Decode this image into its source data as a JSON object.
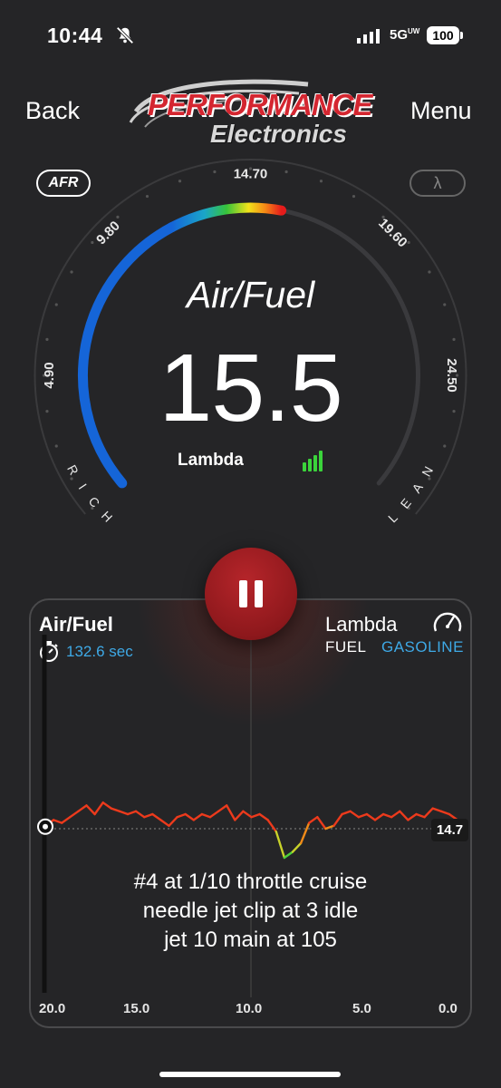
{
  "status_bar": {
    "time": "10:44",
    "network": "5G",
    "network_sub": "UW",
    "battery": "100"
  },
  "header": {
    "back_label": "Back",
    "menu_label": "Menu",
    "logo_line1": "PERFORMANCE",
    "logo_line2": "Electronics"
  },
  "gauge": {
    "mode_afr": "AFR",
    "mode_lambda": "λ",
    "title": "Air/Fuel",
    "value": "15.5",
    "unit_label": "Lambda",
    "scale_labels": [
      "4.90",
      "9.80",
      "14.70",
      "19.60",
      "24.50"
    ],
    "rich_label": "RICH",
    "lean_label": "LEAN",
    "scale_min": 4.9,
    "scale_max": 24.5,
    "current": 15.5,
    "signal_bars": 4,
    "colors": {
      "arc_blue": "#1565d8",
      "signal": "#3bd43b"
    }
  },
  "controls": {
    "pause_icon": "pause-icon"
  },
  "chart_panel": {
    "title": "Air/Fuel",
    "timer": "132.6 sec",
    "right_title": "Lambda",
    "fuel_label": "FUEL",
    "fuel_value": "GASOLINE",
    "current_value": "14.7",
    "note": "#4 at 1/10 throttle cruise\nneedle jet clip at 3 idle\njet 10 main at 105",
    "x_ticks": [
      "20.0",
      "15.0",
      "10.0",
      "5.0",
      "0.0"
    ]
  },
  "chart_data": {
    "type": "line",
    "xlabel": "",
    "ylabel": "",
    "xlim": [
      20.0,
      0.0
    ],
    "reference_value": 14.7,
    "series": [
      {
        "x": [
          20.0,
          19.6,
          19.2,
          18.8,
          18.4,
          18.0,
          17.6,
          17.2,
          16.8,
          16.4,
          16.0,
          15.6,
          15.2,
          14.8,
          14.4,
          14.0,
          13.6,
          13.2,
          12.8,
          12.4,
          12.0,
          11.6,
          11.2,
          10.8,
          10.4,
          10.0,
          9.6,
          9.2,
          8.8,
          8.4,
          8.0,
          7.6,
          7.2,
          6.8,
          6.4,
          6.0,
          5.6,
          5.2,
          4.8,
          4.4,
          4.0,
          3.6,
          3.2,
          2.8,
          2.4,
          2.0,
          1.6,
          1.2,
          0.8,
          0.4,
          0.0
        ],
        "values": [
          14.8,
          15.0,
          14.9,
          15.1,
          15.3,
          15.5,
          15.2,
          15.6,
          15.4,
          15.3,
          15.2,
          15.3,
          15.1,
          15.2,
          15.0,
          14.8,
          15.1,
          15.2,
          15.0,
          15.2,
          15.1,
          15.3,
          15.5,
          15.0,
          15.3,
          15.1,
          15.2,
          15.0,
          14.6,
          13.7,
          13.9,
          14.2,
          14.9,
          15.1,
          14.7,
          14.8,
          15.2,
          15.3,
          15.1,
          15.2,
          15.0,
          15.2,
          15.1,
          15.3,
          15.0,
          15.2,
          15.1,
          15.4,
          15.3,
          15.2,
          15.0
        ]
      }
    ]
  }
}
